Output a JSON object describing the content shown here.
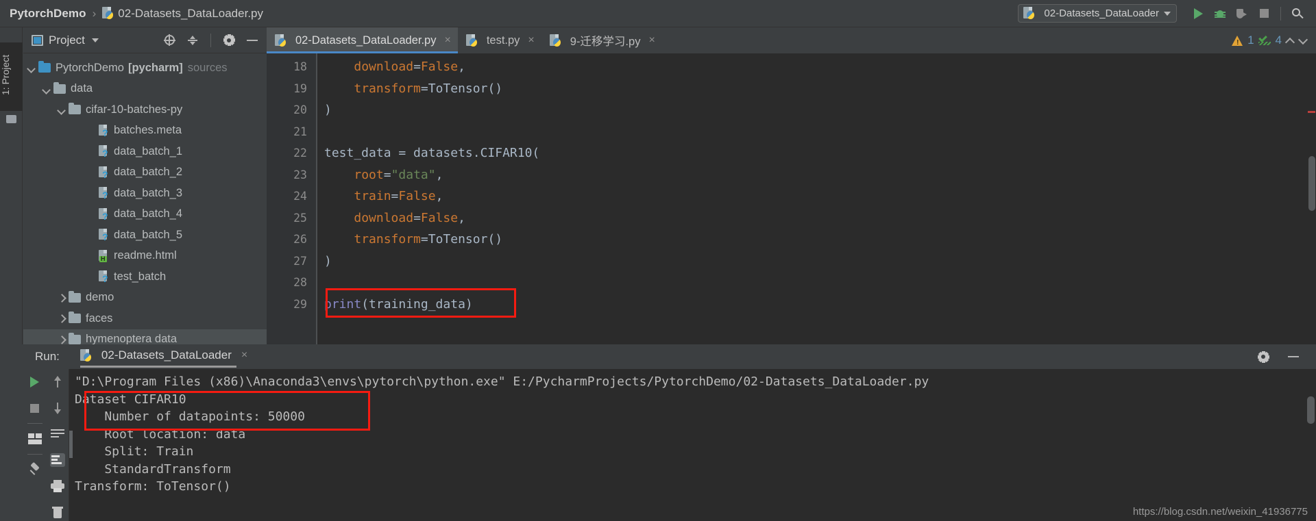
{
  "breadcrumb": {
    "project": "PytorchDemo",
    "separator": "›",
    "file": "02-Datasets_DataLoader.py"
  },
  "toolbar": {
    "run_config": "02-Datasets_DataLoader",
    "run_button": "▶",
    "debug_button": "debug",
    "coverage_button": "coverage",
    "stop_button": "stop",
    "search_button": "search"
  },
  "left_strip": {
    "project_tab": "1: Project",
    "structure_tab": "Structure"
  },
  "project_panel": {
    "title": "Project",
    "tree": [
      {
        "indent": 0,
        "arrow": "open",
        "icon": "folder-blue",
        "label": "PytorchDemo",
        "bold": "[pycharm]",
        "suffix": "sources",
        "selected": false
      },
      {
        "indent": 1,
        "arrow": "open",
        "icon": "folder",
        "label": "data",
        "selected": false
      },
      {
        "indent": 2,
        "arrow": "open",
        "icon": "folder",
        "label": "cifar-10-batches-py",
        "selected": false
      },
      {
        "indent": 4,
        "arrow": "none",
        "icon": "file-unknown",
        "label": "batches.meta",
        "selected": false
      },
      {
        "indent": 4,
        "arrow": "none",
        "icon": "file-unknown",
        "label": "data_batch_1",
        "selected": false
      },
      {
        "indent": 4,
        "arrow": "none",
        "icon": "file-unknown",
        "label": "data_batch_2",
        "selected": false
      },
      {
        "indent": 4,
        "arrow": "none",
        "icon": "file-unknown",
        "label": "data_batch_3",
        "selected": false
      },
      {
        "indent": 4,
        "arrow": "none",
        "icon": "file-unknown",
        "label": "data_batch_4",
        "selected": false
      },
      {
        "indent": 4,
        "arrow": "none",
        "icon": "file-unknown",
        "label": "data_batch_5",
        "selected": false
      },
      {
        "indent": 4,
        "arrow": "none",
        "icon": "file-html",
        "label": "readme.html",
        "selected": false
      },
      {
        "indent": 4,
        "arrow": "none",
        "icon": "file-unknown",
        "label": "test_batch",
        "selected": false
      },
      {
        "indent": 2,
        "arrow": "closed",
        "icon": "folder",
        "label": "demo",
        "selected": false
      },
      {
        "indent": 2,
        "arrow": "closed",
        "icon": "folder",
        "label": "faces",
        "selected": false
      },
      {
        "indent": 2,
        "arrow": "closed",
        "icon": "folder",
        "label": "hymenoptera data",
        "selected": true
      }
    ]
  },
  "editor": {
    "tabs": [
      {
        "label": "02-Datasets_DataLoader.py",
        "active": true,
        "close": "×"
      },
      {
        "label": "test.py",
        "active": false,
        "close": "×"
      },
      {
        "label": "9-迁移学习.py",
        "active": false,
        "close": "×"
      }
    ],
    "inspection": {
      "warning_count": "1",
      "ok_count": "4"
    },
    "first_line_number": 18,
    "lines": [
      {
        "n": "18",
        "tokens": [
          {
            "t": "    ",
            "c": "par"
          },
          {
            "t": "download",
            "c": "kw"
          },
          {
            "t": "=",
            "c": "par"
          },
          {
            "t": "False",
            "c": "kw"
          },
          {
            "t": ",",
            "c": "par"
          }
        ]
      },
      {
        "n": "19",
        "tokens": [
          {
            "t": "    ",
            "c": "par"
          },
          {
            "t": "transform",
            "c": "kw"
          },
          {
            "t": "=",
            "c": "par"
          },
          {
            "t": "ToTensor",
            "c": "fn"
          },
          {
            "t": "()",
            "c": "par"
          }
        ]
      },
      {
        "n": "20",
        "tokens": [
          {
            "t": ")",
            "c": "par"
          }
        ]
      },
      {
        "n": "21",
        "tokens": [
          {
            "t": "",
            "c": "par"
          }
        ]
      },
      {
        "n": "22",
        "tokens": [
          {
            "t": "test_data = datasets.CIFAR10(",
            "c": "par"
          }
        ]
      },
      {
        "n": "23",
        "tokens": [
          {
            "t": "    ",
            "c": "par"
          },
          {
            "t": "root",
            "c": "kw"
          },
          {
            "t": "=",
            "c": "par"
          },
          {
            "t": "\"data\"",
            "c": "str"
          },
          {
            "t": ",",
            "c": "par"
          }
        ]
      },
      {
        "n": "24",
        "tokens": [
          {
            "t": "    ",
            "c": "par"
          },
          {
            "t": "train",
            "c": "kw"
          },
          {
            "t": "=",
            "c": "par"
          },
          {
            "t": "False",
            "c": "kw"
          },
          {
            "t": ",",
            "c": "par"
          }
        ]
      },
      {
        "n": "25",
        "tokens": [
          {
            "t": "    ",
            "c": "par"
          },
          {
            "t": "download",
            "c": "kw"
          },
          {
            "t": "=",
            "c": "par"
          },
          {
            "t": "False",
            "c": "kw"
          },
          {
            "t": ",",
            "c": "par"
          }
        ]
      },
      {
        "n": "26",
        "tokens": [
          {
            "t": "    ",
            "c": "par"
          },
          {
            "t": "transform",
            "c": "kw"
          },
          {
            "t": "=",
            "c": "par"
          },
          {
            "t": "ToTensor",
            "c": "fn"
          },
          {
            "t": "()",
            "c": "par"
          }
        ]
      },
      {
        "n": "27",
        "tokens": [
          {
            "t": ")",
            "c": "par"
          }
        ]
      },
      {
        "n": "28",
        "tokens": [
          {
            "t": "",
            "c": "par"
          }
        ]
      },
      {
        "n": "29",
        "tokens": [
          {
            "t": "print",
            "c": "bi"
          },
          {
            "t": "(training_data)",
            "c": "par"
          }
        ]
      }
    ],
    "highlight_box_label": "print(training_data)"
  },
  "run_panel": {
    "label": "Run:",
    "tab_name": "02-Datasets_DataLoader",
    "tab_close": "×",
    "console_lines": [
      "\"D:\\Program Files (x86)\\Anaconda3\\envs\\pytorch\\python.exe\" E:/PycharmProjects/PytorchDemo/02-Datasets_DataLoader.py",
      "Dataset CIFAR10",
      "    Number of datapoints: 50000",
      "    Root location: data",
      "    Split: Train",
      "    StandardTransform",
      "Transform: ToTensor()"
    ],
    "highlighted_lines": [
      "Dataset CIFAR10",
      "    Number of datapoints: 50000"
    ]
  },
  "watermark": "https://blog.csdn.net/weixin_41936775",
  "colors": {
    "accent_blue": "#4a88c7",
    "highlight_red": "#f51b11",
    "keyword_orange": "#cc7832",
    "string_green": "#6a8759",
    "run_green": "#59a869",
    "background": "#3c3f41",
    "editor_bg": "#2b2b2b"
  }
}
